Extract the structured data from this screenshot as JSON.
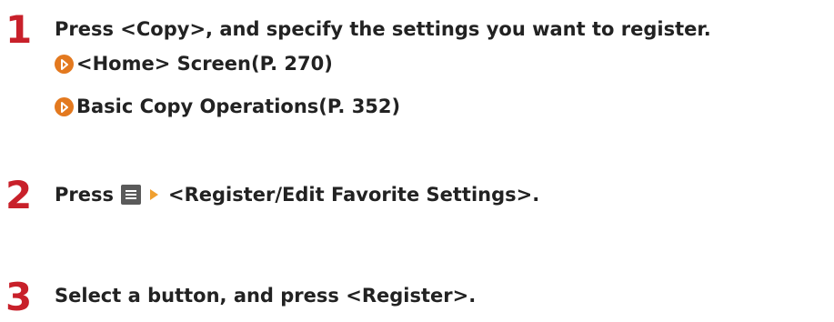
{
  "steps": [
    {
      "number": "1",
      "text": "Press <Copy>, and specify the settings you want to register.",
      "links": [
        {
          "label": "<Home> Screen(P. 270)"
        },
        {
          "label": "Basic Copy Operations(P. 352)"
        }
      ]
    },
    {
      "number": "2",
      "text_before": "Press",
      "text_after": "<Register/Edit Favorite Settings>."
    },
    {
      "number": "3",
      "text": "Select a button, and press <Register>."
    }
  ],
  "colors": {
    "step_number": "#c8202a",
    "link_icon": "#e3791f",
    "menu_icon": "#5a5a5a",
    "arrow": "#f0a030"
  },
  "icons": {
    "link": "circle-arrow-icon",
    "menu": "menu-icon",
    "next": "triangle-right-icon"
  }
}
